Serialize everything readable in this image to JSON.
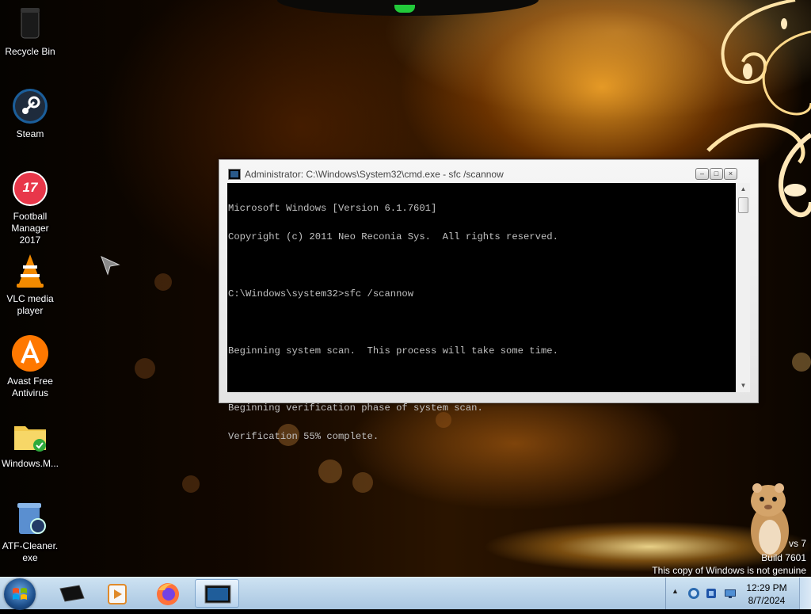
{
  "desktop": {
    "icons": [
      {
        "label_line1": "Recycle Bin",
        "label_line2": "",
        "icon": "recycle-bin-icon"
      },
      {
        "label_line1": "Steam",
        "label_line2": "",
        "icon": "steam-icon"
      },
      {
        "label_line1": "Football",
        "label_line2": "Manager 2017",
        "icon": "football-manager-icon",
        "badge": "17"
      },
      {
        "label_line1": "VLC media",
        "label_line2": "player",
        "icon": "vlc-cone-icon"
      },
      {
        "label_line1": "Avast Free",
        "label_line2": "Antivirus",
        "icon": "avast-icon"
      },
      {
        "label_line1": "Windows.M...",
        "label_line2": "",
        "icon": "folder-shield-icon"
      },
      {
        "label_line1": "ATF-Cleaner.",
        "label_line2": "exe",
        "icon": "atf-cleaner-icon"
      }
    ],
    "watermark": {
      "line1": "vs 7",
      "line2": "Build 7601",
      "line3": "This copy of Windows is not genuine"
    }
  },
  "cmd_window": {
    "title": "Administrator: C:\\Windows\\System32\\cmd.exe - sfc  /scannow",
    "controls": {
      "minimize": "–",
      "maximize": "□",
      "close": "×"
    },
    "lines": [
      "Microsoft Windows [Version 6.1.7601]",
      "Copyright (c) 2011 Neo Reconia Sys.  All rights reserved.",
      "",
      "C:\\Windows\\system32>sfc /scannow",
      "",
      "Beginning system scan.  This process will take some time.",
      "",
      "Beginning verification phase of system scan.",
      "Verification 55% complete."
    ]
  },
  "taskbar": {
    "pinned": [
      {
        "name": "tablet-app-icon"
      },
      {
        "name": "media-player-icon"
      },
      {
        "name": "firefox-icon"
      },
      {
        "name": "cmd-window-icon",
        "active": true
      }
    ],
    "tray": {
      "show_hidden": "▲",
      "time": "12:29 PM",
      "date": "8/7/2024"
    }
  },
  "colors": {
    "console_bg": "#000000",
    "console_text": "#c0c0c0",
    "taskbar_top": "#cde2f2",
    "taskbar_bottom": "#a9c6e1"
  }
}
